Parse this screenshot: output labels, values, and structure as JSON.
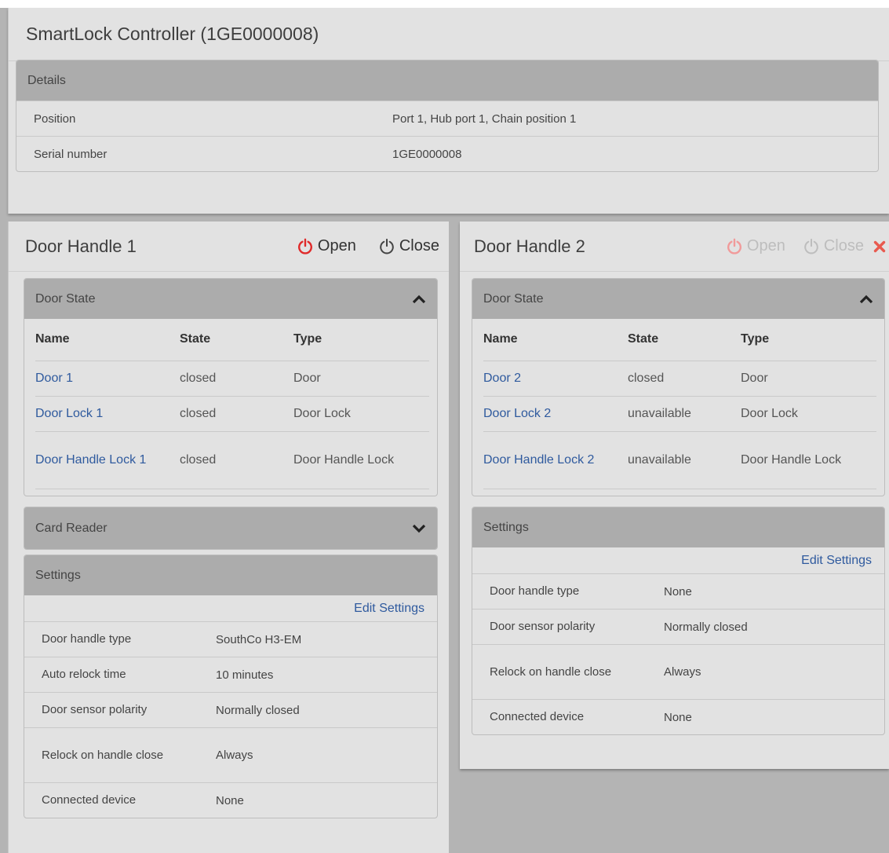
{
  "controller": {
    "title": "SmartLock Controller (1GE0000008)",
    "details": {
      "header": "Details",
      "rows": [
        {
          "key": "Position",
          "value": "Port 1, Hub port 1, Chain position 1"
        },
        {
          "key": "Serial number",
          "value": "1GE0000008"
        }
      ]
    }
  },
  "handle1": {
    "title": "Door Handle 1",
    "open_label": "Open",
    "close_label": "Close",
    "door_state": {
      "header": "Door State",
      "columns": [
        "Name",
        "State",
        "Type"
      ],
      "rows": [
        {
          "name": "Door 1",
          "state": "closed",
          "type": "Door"
        },
        {
          "name": "Door Lock 1",
          "state": "closed",
          "type": "Door Lock"
        },
        {
          "name": "Door Handle Lock 1",
          "state": "closed",
          "type": "Door Handle Lock"
        }
      ]
    },
    "card_reader": {
      "header": "Card Reader"
    },
    "settings": {
      "header": "Settings",
      "edit_label": "Edit Settings",
      "rows": [
        {
          "key": "Door handle type",
          "value": "SouthCo H3-EM"
        },
        {
          "key": "Auto relock time",
          "value": "10 minutes"
        },
        {
          "key": "Door sensor polarity",
          "value": "Normally closed"
        },
        {
          "key": "Relock on handle close",
          "value": "Always"
        },
        {
          "key": "Connected device",
          "value": "None"
        }
      ]
    }
  },
  "handle2": {
    "title": "Door Handle 2",
    "open_label": "Open",
    "close_label": "Close",
    "door_state": {
      "header": "Door State",
      "columns": [
        "Name",
        "State",
        "Type"
      ],
      "rows": [
        {
          "name": "Door 2",
          "state": "closed",
          "type": "Door"
        },
        {
          "name": "Door Lock 2",
          "state": "unavailable",
          "type": "Door Lock"
        },
        {
          "name": "Door Handle Lock 2",
          "state": "unavailable",
          "type": "Door Handle Lock"
        }
      ]
    },
    "settings": {
      "header": "Settings",
      "edit_label": "Edit Settings",
      "rows": [
        {
          "key": "Door handle type",
          "value": "None"
        },
        {
          "key": "Door sensor polarity",
          "value": "Normally closed"
        },
        {
          "key": "Relock on handle close",
          "value": "Always"
        },
        {
          "key": "Connected device",
          "value": "None"
        }
      ]
    }
  },
  "colors": {
    "link": "#2f5a9e",
    "power_red": "#e02a2a",
    "close_x": "#e85a4f",
    "header_gray": "#acacac"
  },
  "icons": {
    "open": "power-icon",
    "close": "power-icon",
    "expanded": "chevron-up-icon",
    "collapsed": "chevron-down-icon",
    "remove": "close-x-icon"
  }
}
